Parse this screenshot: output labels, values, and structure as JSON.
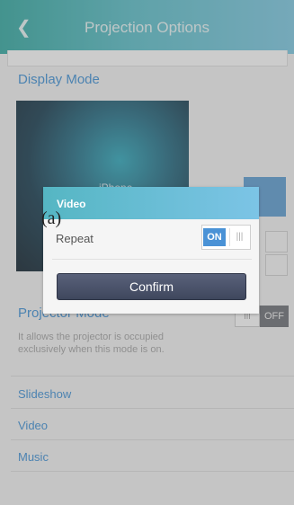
{
  "header": {
    "back_icon": "chevron-left",
    "title": "Projection Options"
  },
  "display_mode": {
    "title": "Display Mode",
    "preview_label": "iPhone"
  },
  "projector_mode": {
    "title": "Projector Mode",
    "description": "It allows the projector is occupied exclusively when this mode is on.",
    "toggle_knob": "III",
    "toggle_state": "OFF"
  },
  "list": {
    "items": [
      "Slideshow",
      "Video",
      "Music"
    ]
  },
  "dialog": {
    "title": "Video",
    "repeat_label": "Repeat",
    "toggle_state": "ON",
    "toggle_grip": "|||",
    "confirm_label": "Confirm"
  },
  "annotation": "(a)",
  "colors": {
    "accent_blue": "#3b8fd6",
    "header_teal": "#2ea8a0",
    "confirm_dark": "#3f475d",
    "toggle_on": "#4a92d6"
  }
}
